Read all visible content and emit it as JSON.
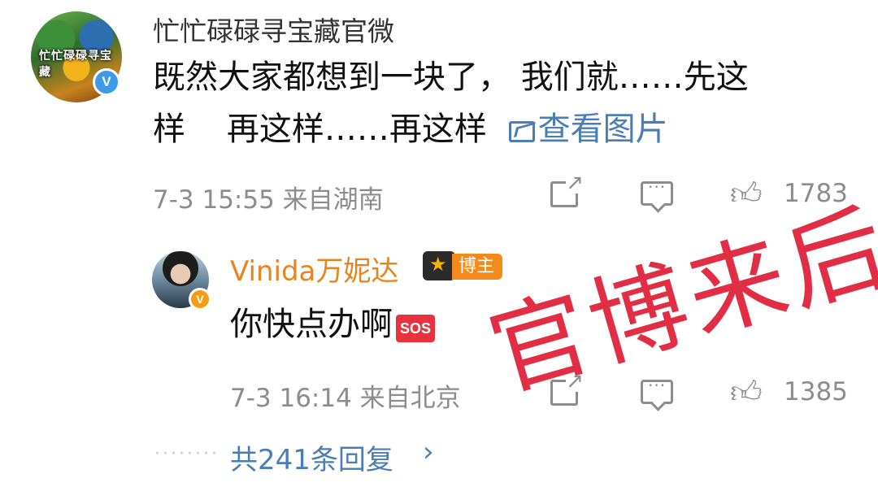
{
  "main_comment": {
    "avatar_text": "忙忙碌碌寻宝藏",
    "author": "忙忙碌碌寻宝藏官微",
    "verified_badge": "V",
    "text_line1": "既然大家都想到一块了， 我们就……先这",
    "text_line2": "样    再这样……再这样 ",
    "view_picture_label": "查看图片",
    "time_location": "7-3 15:55  来自湖南",
    "like_count": "1783",
    "icons": [
      "picture-icon",
      "share-icon",
      "comment-icon",
      "like-icon"
    ]
  },
  "reply": {
    "author": "Vinida万妮达",
    "verified_badge": "V",
    "blogger_badge": "博主",
    "text": "你快点办啊",
    "sos_emoji": "SOS",
    "time_location": "7-3 16:14  来自北京",
    "like_count": "1385",
    "icons": [
      "crown-icon",
      "share-icon",
      "comment-icon",
      "like-icon"
    ]
  },
  "more_replies": {
    "label": "共241条回复",
    "chevron": "›"
  },
  "overlay": {
    "stamp_text": "官博来后",
    "stamp_color": "#e0233a"
  },
  "colors": {
    "link_blue": "#4a7db5",
    "reply_author_orange": "#e8841e",
    "meta_gray": "#8c8c8c",
    "verified_blue": "#3c9ae8",
    "verified_orange": "#f59d10"
  }
}
